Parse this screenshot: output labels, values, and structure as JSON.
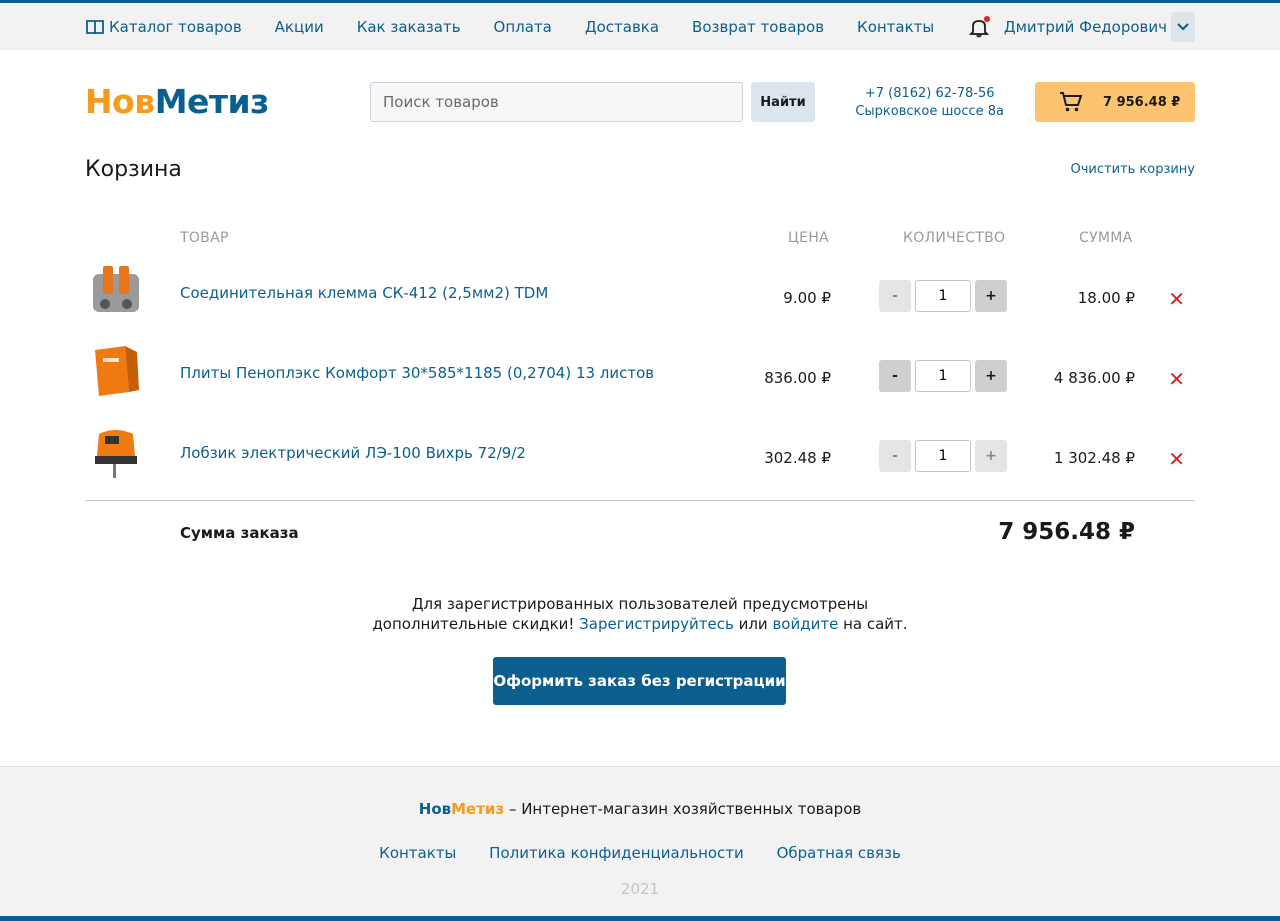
{
  "topnav": {
    "items": [
      "Каталог товаров",
      "Акции",
      "Как заказать",
      "Оплата",
      "Доставка",
      "Возврат товаров",
      "Контакты"
    ],
    "user_name": "Дмитрий Федорович"
  },
  "header": {
    "logo_part1": "Нов",
    "logo_part2": "Метиз",
    "search_placeholder": "Поиск товаров",
    "search_button": "Найти",
    "phone": "+7 (8162) 62-78-56",
    "address": "Сырковское шоссе 8а",
    "cart_total": "7 956.48 ₽"
  },
  "cart": {
    "title": "Корзина",
    "clear_label": "Очистить корзину",
    "columns": {
      "product": "ТОВАР",
      "price": "ЦЕНА",
      "quantity": "КОЛИЧЕСТВО",
      "sum": "СУММА"
    },
    "items": [
      {
        "name": "Соединительная клемма СК-412 (2,5мм2) TDM",
        "price": "9.00 ₽",
        "qty": "1",
        "sum": "18.00 ₽"
      },
      {
        "name": "Плиты Пеноплэкс Комфорт 30*585*1185 (0,2704) 13 листов",
        "price": "836.00 ₽",
        "qty": "1",
        "sum": "4 836.00 ₽"
      },
      {
        "name": "Лобзик электрический ЛЭ-100 Вихрь 72/9/2",
        "price": "302.48 ₽",
        "qty": "1",
        "sum": "1 302.48 ₽"
      }
    ],
    "minus_label": "-",
    "plus_label": "+",
    "total_label": "Сумма заказа",
    "total_value": "7 956.48 ₽"
  },
  "note": {
    "line1": "Для зарегистрированных пользователей предусмотрены",
    "line2_start": "дополнительные скидки! ",
    "register_link": "Зарегистрируйтесь",
    "or": " или ",
    "login_link": "войдите",
    "line2_end": " на сайт."
  },
  "order_button": "Оформить заказ без регистрации",
  "footer": {
    "brand1": "Нов",
    "brand2": "Метиз",
    "tagline": " – Интернет-магазин хозяйственных товаров",
    "links": [
      "Контакты",
      "Политика конфиденциальности",
      "Обратная связь"
    ],
    "year": "2021"
  },
  "colors": {
    "brand_blue": "#0b5f8f",
    "brand_orange": "#f59a1b",
    "cart_button": "#fdc46f",
    "delete": "#e02020"
  }
}
